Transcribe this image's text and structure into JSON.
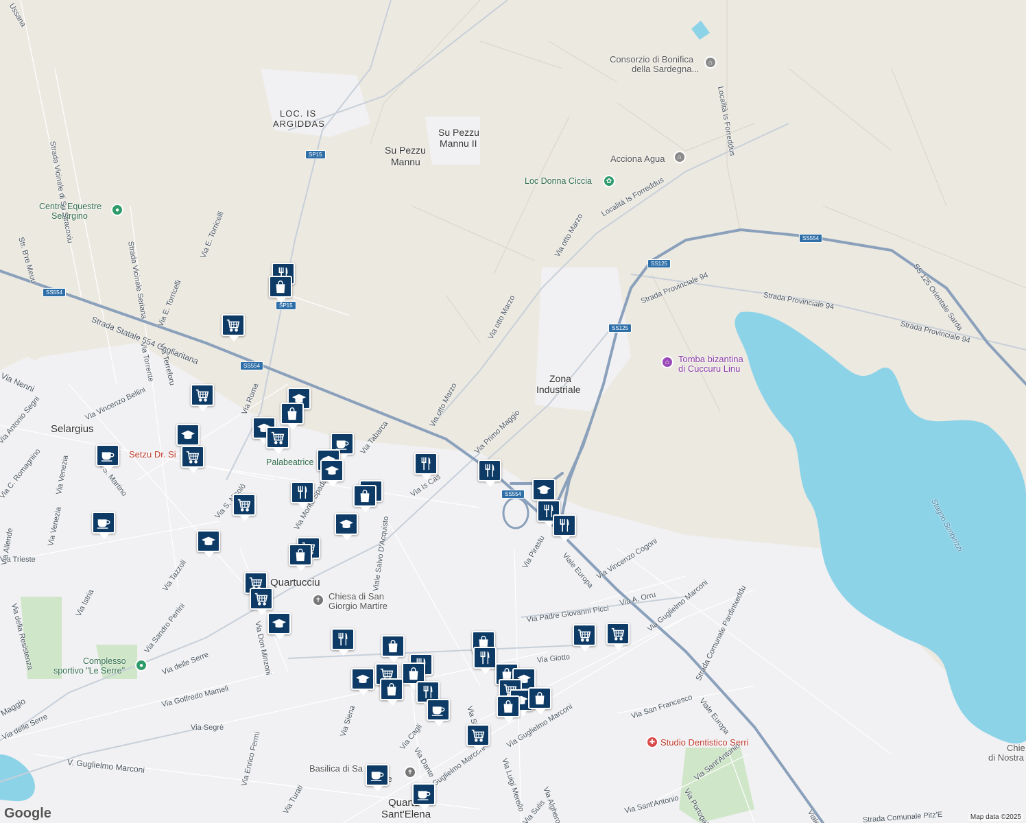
{
  "map": {
    "attribution": "Map data ©2025",
    "logo": "Google",
    "colors": {
      "water": "#8dd3e8",
      "major_road": "#8aa0bb",
      "marker": "#0d3b66",
      "urban": "#f1f1f3",
      "land": "#ece9e1"
    },
    "places": {
      "selargius": "Selargius",
      "quartucciu": "Quartucciu",
      "quartu_a": "Quartu",
      "quartu_b": "Sant'Elena",
      "zona_ind_1": "Zona",
      "zona_ind_2": "Industriale",
      "loc_is_argiddas_1": "LOC. IS",
      "loc_is_argiddas_2": "ARGIDDAS",
      "su_pezzu_1": "Su Pezzu",
      "su_pezzu_2": "Mannu",
      "su_pezzu_ii_1": "Su Pezzu",
      "su_pezzu_ii_2": "Mannu II"
    },
    "pois": {
      "consorzio_1": "Consorzio di Bonifica",
      "consorzio_2": "della Sardegna...",
      "acciona": "Acciona Agua",
      "loc_donna_ciccia": "Loc Donna Ciccia",
      "centro_equestre_1": "Centro Equestre",
      "centro_equestre_2": "Selargino",
      "tomba_1": "Tomba bizantina",
      "tomba_2": "di Cuccuru Linu",
      "setzu": "Setzu Dr. Si",
      "palabeatrice": "Palabeatrice",
      "chiesa_1": "Chiesa di San",
      "chiesa_2": "Giorgio Martire",
      "complesso_1": "Complesso",
      "complesso_2": "sportivo \"Le Serre\"",
      "studio": "Studio Dentistico Serri",
      "basilica_1": "Basilica di Sa",
      "basilica_2": "Impe",
      "chie_1": "Chie",
      "chie_2": "di Nostra"
    },
    "water_labels": {
      "stagno": "Stagno Simbirizzi"
    },
    "shields": {
      "sp15_a": "SP15",
      "sp15_b": "SP15",
      "ss554_a": "SS554",
      "ss554_b": "SS554",
      "ss554_c": "SS554",
      "ss554_d": "SS554",
      "ss125_a": "SS125",
      "ss125_b": "SS125"
    },
    "roads": {
      "r1": "Strada Statale 554 Cagliaritana",
      "r2": "Strada Vicinale di Su Stracoxiu",
      "r3": "Strada Vicinale Seriana",
      "r4": "Via E. Torricelli",
      "r5": "Via E. Torricelli",
      "r6": "Via Terreforu",
      "r7": "Via Torrente",
      "r8": "Via Roma",
      "r9": "Via Vincenzo Bellini",
      "r10": "Via Tabarca",
      "r11": "Via otto Marzo",
      "r12": "Via otto Marzo",
      "r13": "Via otto Marzo",
      "r14": "Località Is Forreddus",
      "r15": "Località Is Forreddus",
      "r16": "Strada Provinciale 94",
      "r17": "Strada Provinciale 94",
      "r18": "Strada Provinciale 94",
      "r19": "SS 125 Orientale Sarda",
      "r20": "Via Primo Maggio",
      "r21": "Viale Europa",
      "r22": "Viale Europa",
      "r23": "Via Vincenzo Cogoni",
      "r24": "Via Padre Giovanni Picci",
      "r25": "Via A. Orru",
      "r26": "Via Guglielmo Marconi",
      "r27": "Strada Comunale Pardinixeddu",
      "r28": "Via San Francesco",
      "r29": "Via Sant'Antonio",
      "r30": "Via Sant'Antonio",
      "r31": "Via Giotto",
      "r32": "Via Guglielmo Marconi",
      "r33": "Via Pirastu",
      "r34": "Viale Salvo D'Acquisto",
      "r35": "Via Monte Spada",
      "r36": "Via S. Nicolò",
      "r37": "Via S. Martino",
      "r38": "Via Tazzoli",
      "r39": "Via Istria",
      "r40": "Via della Resistenza",
      "r41": "Via Sandro Pertini",
      "r42": "Via delle Serre",
      "r43": "Via Don Minzoni",
      "r44": "Via Goffredo Mameli",
      "r45": "Via Segrè",
      "r46": "Via Enrico Fermi",
      "r47": "V. Guglielmo Marconi",
      "r48": "Via delle Serre",
      "r49": "Via Siena",
      "r50": "Via Dante",
      "r51": "Via Luigi Merello",
      "r52": "Via Alghero",
      "r53": "Via Sulis",
      "r54": "Via Portogallo",
      "r55": "Via Trieste",
      "r56": "Via Venezia",
      "r57": "Via Venezia",
      "r58": "Via Allende",
      "r59": "Via C. Romagnino",
      "r60": "Via Antonio Segni",
      "r61": "Str. B're Meuu",
      "r62": "Via Nenni",
      "r63": "Via Cagli",
      "r64": "Via Sic",
      "r65": "Maggio",
      "r66": "Strada Comunale Pitz'E",
      "r67": "Viale",
      "r68": "Ussana",
      "r69": "Via Turati",
      "r70": "Guglielmo Marconi",
      "r71": "Via Is Cas"
    }
  }
}
